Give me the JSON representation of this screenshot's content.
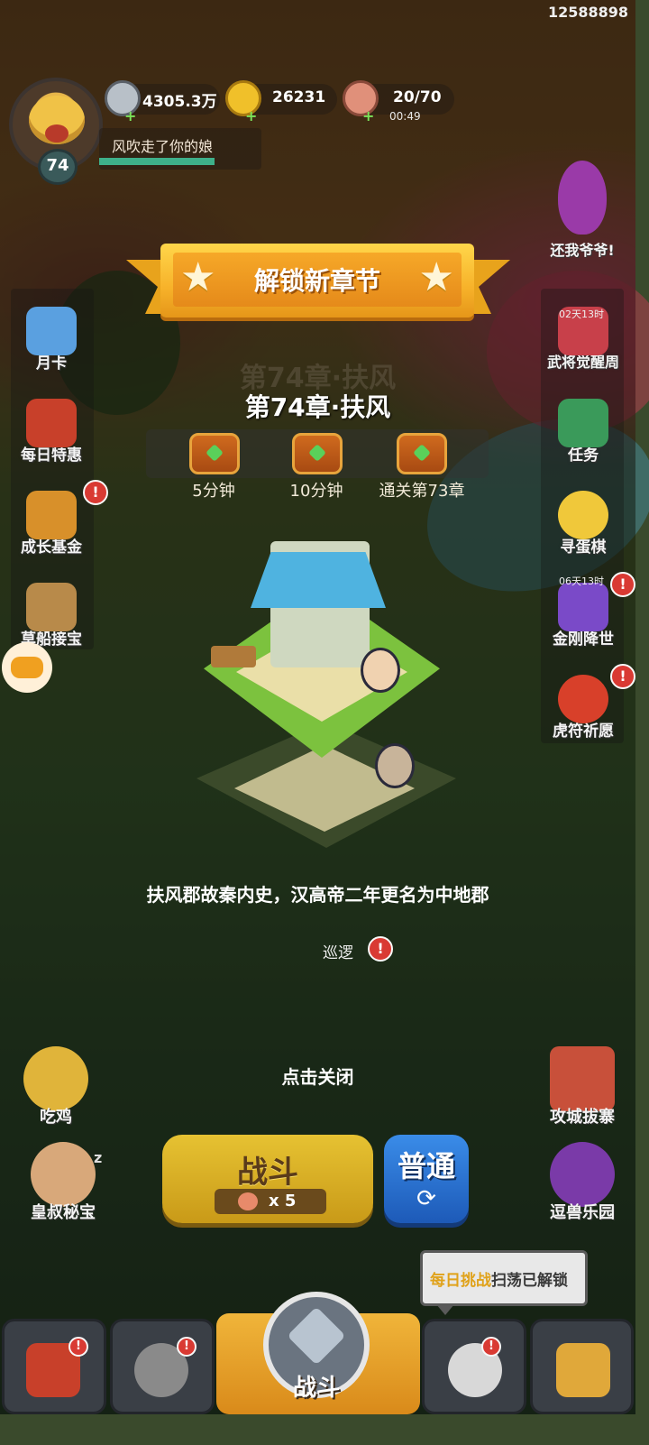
{
  "device_id": "12588898",
  "player": {
    "level": "74",
    "name": "风吹走了你的娘",
    "exp_fraction": 0.72
  },
  "resources": {
    "silver": "4305.3万",
    "gold": "26231",
    "stamina": "20/70",
    "stamina_timer": "00:49",
    "plus": "+"
  },
  "left_menu": [
    {
      "label": "月卡",
      "badge": ""
    },
    {
      "label": "每日特惠",
      "badge": ""
    },
    {
      "label": "成长基金",
      "badge": "!"
    },
    {
      "label": "草船接宝",
      "badge": ""
    }
  ],
  "right_menu": {
    "top_event": "还我爷爷!",
    "items": [
      {
        "label": "武将觉醒周",
        "timer": "02天13时",
        "badge": ""
      },
      {
        "label": "任务",
        "timer": "",
        "badge": ""
      },
      {
        "label": "寻蛋棋",
        "timer": "",
        "badge": ""
      },
      {
        "label": "金刚降世",
        "timer": "06天13时",
        "badge": "!"
      },
      {
        "label": "虎符祈愿",
        "timer": "",
        "badge": "!"
      }
    ]
  },
  "popup": {
    "banner_title": "解锁新章节",
    "chapter_ghost": "第74章·扶风",
    "chapter_title": "第74章·扶风",
    "rewards": [
      "5分钟",
      "10分钟",
      "通关第73章"
    ],
    "description": "扶风郡故秦内史，汉高帝二年更名为中地郡",
    "close_hint": "点击关闭"
  },
  "patrol": {
    "label": "巡逻",
    "badge": "!"
  },
  "bottom_left": [
    {
      "label": "吃鸡"
    },
    {
      "label": "皇叔秘宝",
      "extra": "z"
    }
  ],
  "bottom_right": [
    {
      "label": "攻城拔寨"
    },
    {
      "label": "逗兽乐园"
    }
  ],
  "battle": {
    "label": "战斗",
    "cost": "x 5",
    "mode": "普通",
    "mode_icon": "⟳"
  },
  "tip": {
    "highlight": "每日挑战",
    "text": "扫荡已解锁"
  },
  "nav": {
    "center_label": "战斗",
    "badges": [
      "!",
      "!",
      "!"
    ]
  },
  "colors": {
    "banner": "#f7b22a",
    "battle": "#e6c232",
    "mode": "#3a8ce8",
    "badge": "#d93a33"
  }
}
